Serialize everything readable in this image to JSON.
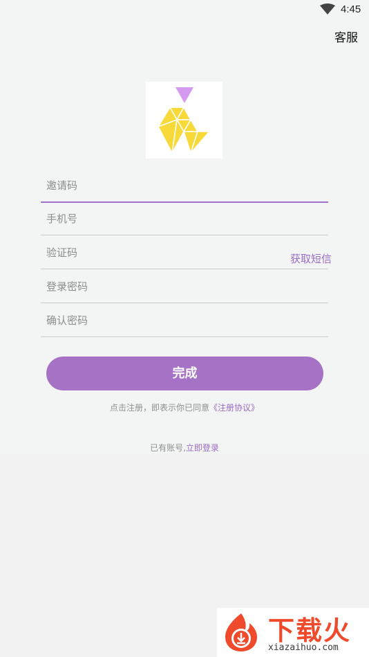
{
  "status_bar": {
    "time": "4:45"
  },
  "header": {
    "service_label": "客服"
  },
  "form": {
    "invite_code_placeholder": "邀请码",
    "phone_placeholder": "手机号",
    "verify_code_placeholder": "验证码",
    "get_sms_label": "获取短信",
    "login_password_placeholder": "登录密码",
    "confirm_password_placeholder": "确认密码"
  },
  "submit_label": "完成",
  "agreement": {
    "prefix": "点击注册，即表示你已同意",
    "link": "《注册协议》"
  },
  "login": {
    "prefix": "已有账号,",
    "link": "立即登录"
  },
  "watermark": {
    "brand": "下载火",
    "site": "xiazaihuo.com"
  },
  "colors": {
    "accent": "#a672c6",
    "logo_yellow": "#f7d93a",
    "logo_purple": "#d49af0"
  }
}
